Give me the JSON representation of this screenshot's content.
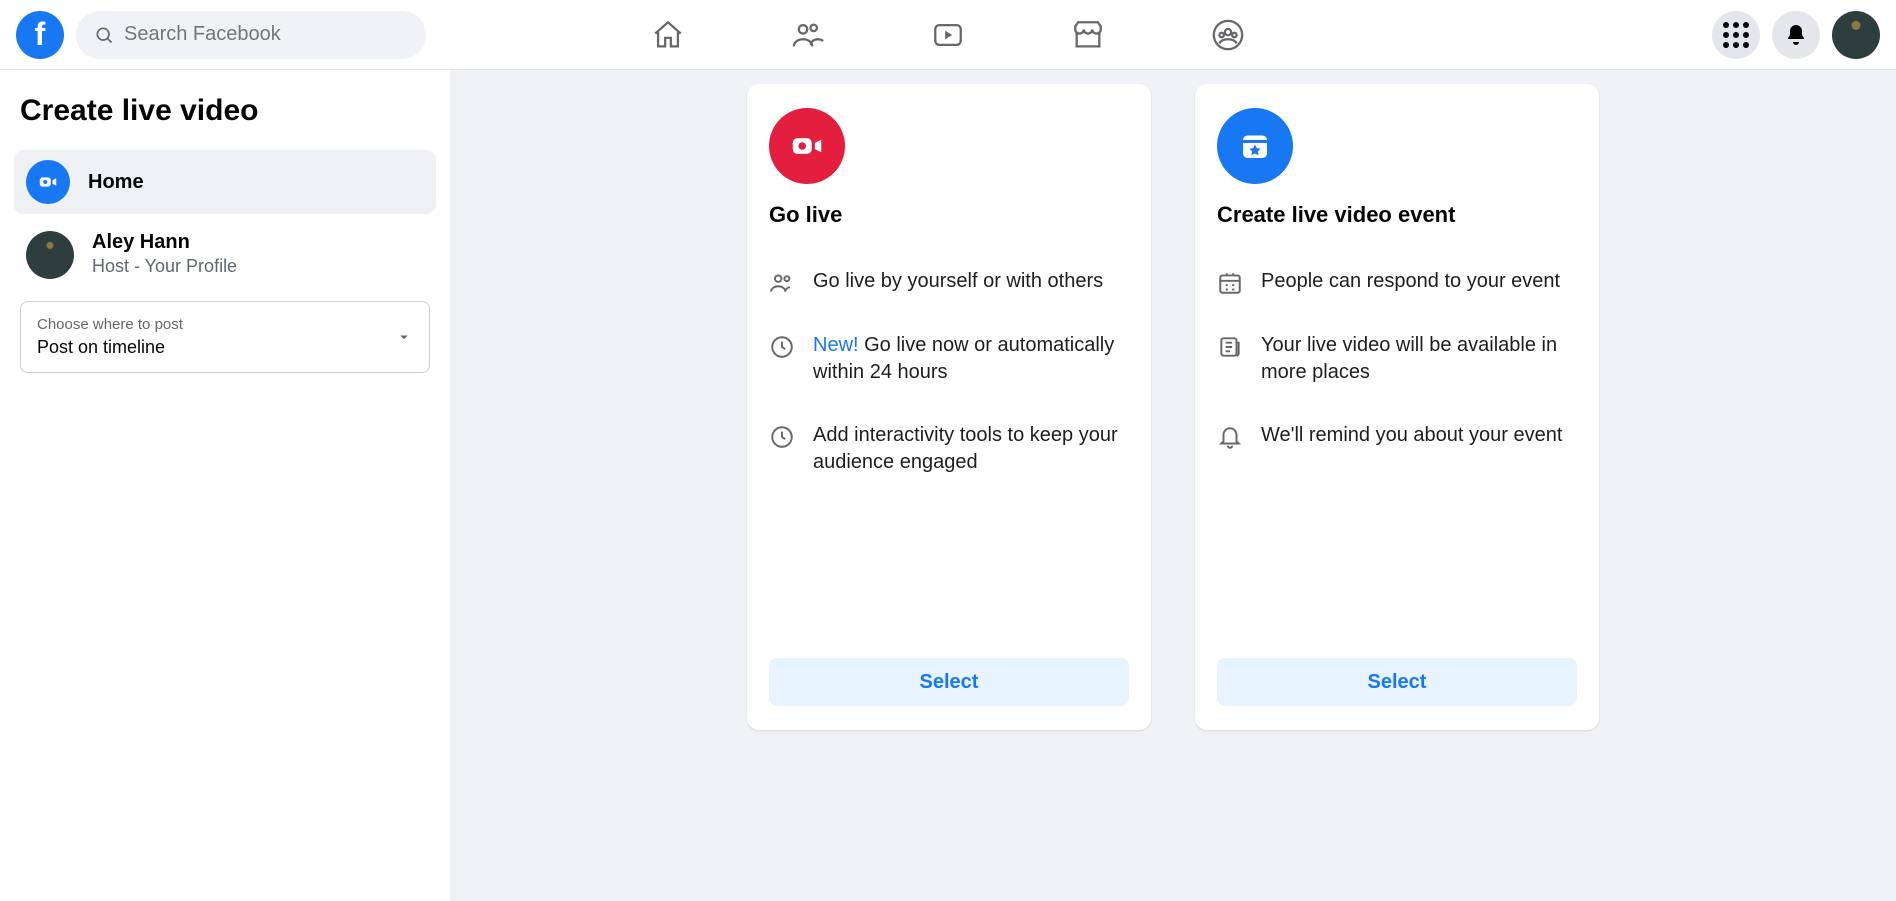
{
  "search": {
    "placeholder": "Search Facebook"
  },
  "sidebar": {
    "title": "Create live video",
    "home_label": "Home",
    "profile_name": "Aley Hann",
    "profile_role": "Host - Your Profile",
    "post_select_label": "Choose where to post",
    "post_select_value": "Post on timeline"
  },
  "cards": {
    "go_live": {
      "title": "Go live",
      "f1": "Go live by yourself or with others",
      "f2_new": "New! ",
      "f2_rest": "Go live now or automatically within 24 hours",
      "f3": "Add interactivity tools to keep your audience engaged",
      "button": "Select"
    },
    "event": {
      "title": "Create live video event",
      "f1": "People can respond to your event",
      "f2": "Your live video will be available in more places",
      "f3": "We'll remind you about your event",
      "button": "Select"
    }
  }
}
